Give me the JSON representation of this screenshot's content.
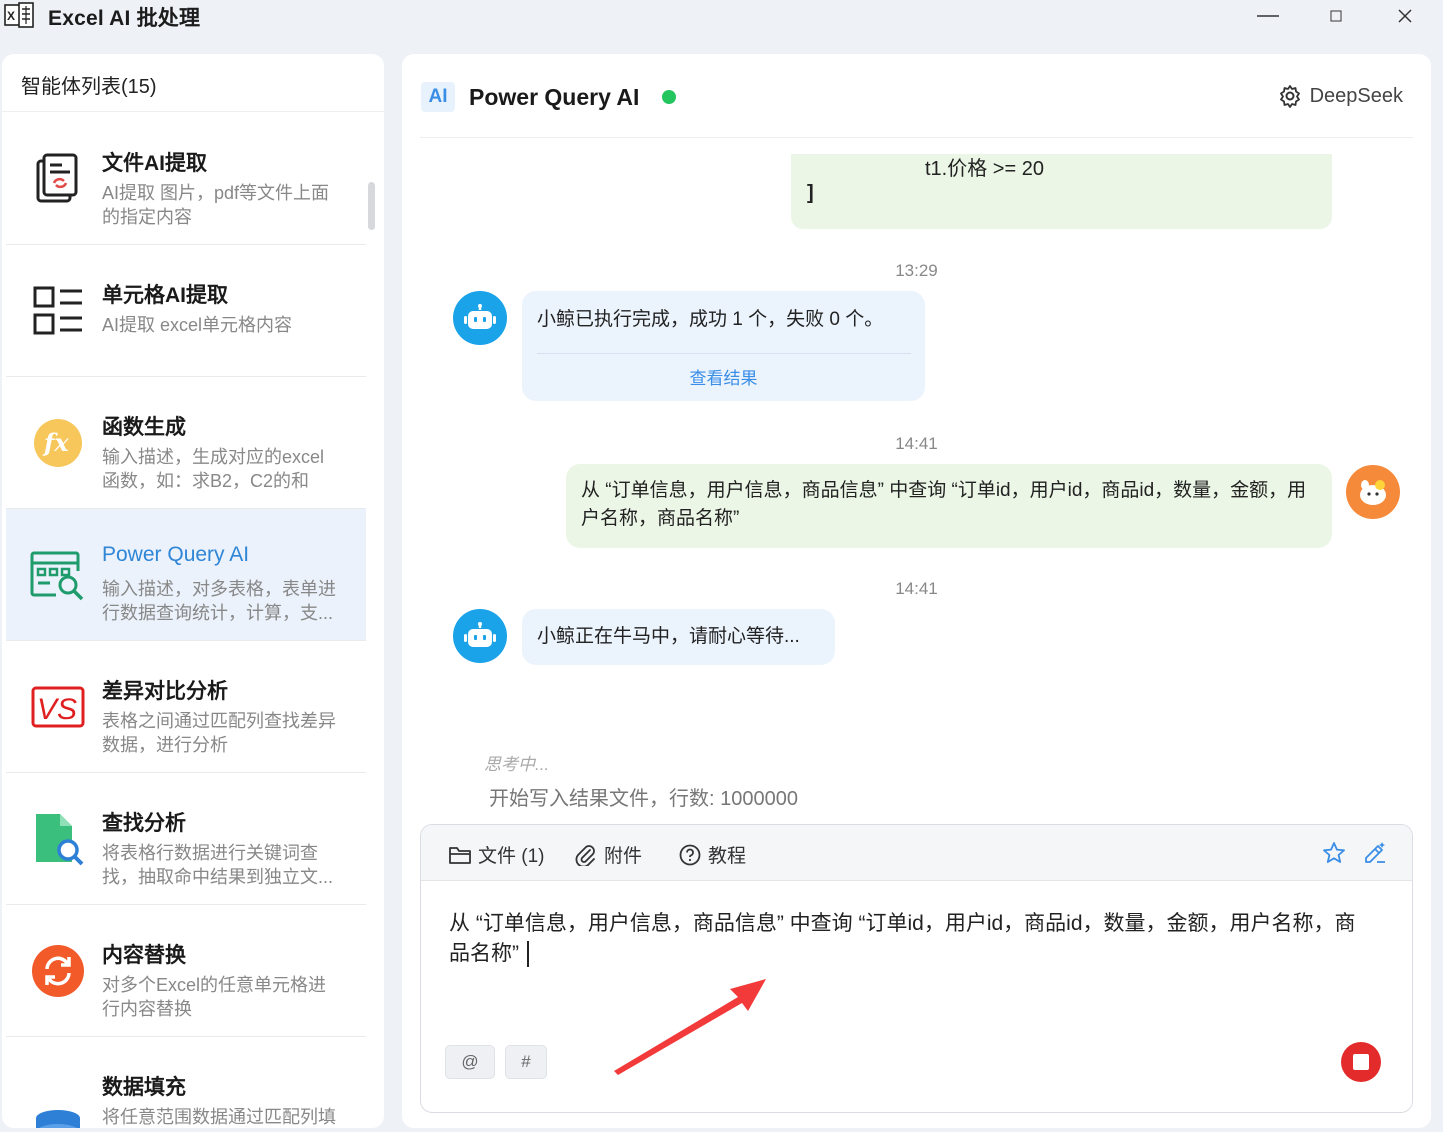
{
  "window": {
    "title": "Excel AI 批处理",
    "minimize_label": "—",
    "maximize_label": "□",
    "close_label": "✕"
  },
  "sidebar": {
    "header": "智能体列表(15)",
    "items": [
      {
        "title": "文件AI提取",
        "desc": "AI提取 图片，pdf等文件上面的指定内容",
        "icon": "document-extract-icon"
      },
      {
        "title": "单元格AI提取",
        "desc": "AI提取 excel单元格内容",
        "icon": "cell-list-icon"
      },
      {
        "title": "函数生成",
        "desc": "输入描述，生成对应的excel函数，如：求B2，C2的和",
        "icon": "fx-icon"
      },
      {
        "title": "Power Query AI",
        "desc": "输入描述，对多表格，表单进行数据查询统计，计算，支...",
        "icon": "table-search-icon"
      },
      {
        "title": "差异对比分析",
        "desc": "表格之间通过匹配列查找差异数据，进行分析",
        "icon": "vs-icon"
      },
      {
        "title": "查找分析",
        "desc": "将表格行数据进行关键词查找，抽取命中结果到独立文...",
        "icon": "file-search-icon"
      },
      {
        "title": "内容替换",
        "desc": "对多个Excel的任意单元格进行内容替换",
        "icon": "refresh-icon"
      },
      {
        "title": "数据填充",
        "desc": "将任意范围数据通过匹配列填",
        "icon": "database-icon"
      }
    ],
    "active_index": 3
  },
  "chat": {
    "badge": "AI",
    "title": "Power Query AI",
    "model": "DeepSeek",
    "prev_code_line1": "t1.价格 >= 20",
    "prev_code_line2": "]",
    "messages": [
      {
        "time": "13:29",
        "role": "bot",
        "text": "小鲸已执行完成，成功 1 个，失败 0 个。",
        "link": "查看结果"
      },
      {
        "time": "14:41",
        "role": "user",
        "text": "从 “订单信息，用户信息，商品信息” 中查询 “订单id，用户id，商品id，数量，金额，用户名称，商品名称”"
      },
      {
        "time": "14:41",
        "role": "bot",
        "text": "小鲸正在牛马中，请耐心等待..."
      }
    ],
    "thinking_label": "思考中...",
    "thinking_text": "开始写入结果文件，行数: 1000000"
  },
  "composer": {
    "file_label": "文件 (1)",
    "attach_label": "附件",
    "tutorial_label": "教程",
    "input_text": "从 “订单信息，用户信息，商品信息” 中查询 “订单id，用户id，商品id，数量，金额，用户名称，商品名称”",
    "at_chip": "@",
    "hash_chip": "#"
  },
  "colors": {
    "accent": "#3a8ee6",
    "online": "#22c55e",
    "stop": "#e32b2b",
    "bot_bubble": "#ebf3fd",
    "user_bubble": "#ebf6e6"
  }
}
